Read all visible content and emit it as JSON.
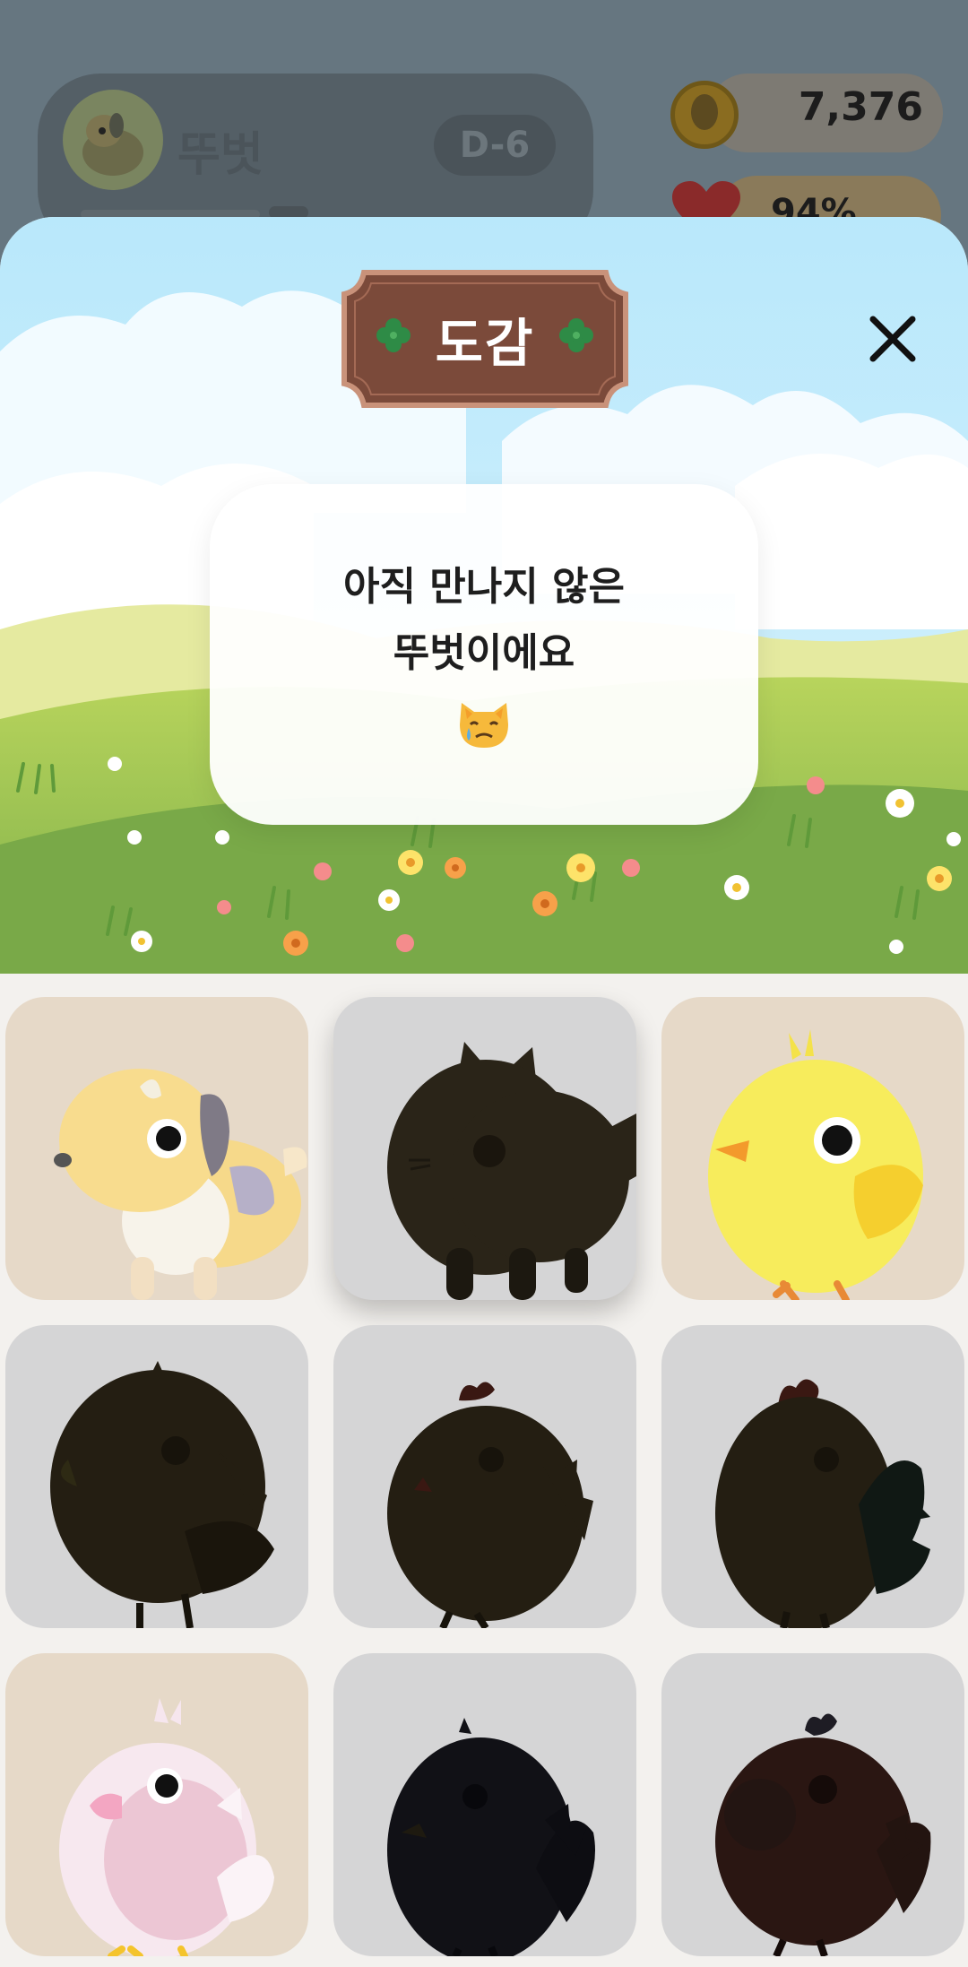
{
  "hud": {
    "pet_name": "뚜벗",
    "dday": "D-6",
    "coins": "7,376",
    "health": "94%"
  },
  "modal": {
    "title": "도감",
    "close_icon": "close-icon",
    "message_line1": "아직 만나지 않은",
    "message_line2": "뚜벗이에요",
    "message_emoji": "crying-cat-emoji"
  },
  "collection": {
    "items": [
      {
        "name": "dog",
        "status": "found",
        "selected": false
      },
      {
        "name": "cat",
        "status": "locked",
        "selected": true
      },
      {
        "name": "chick",
        "status": "found",
        "selected": false
      },
      {
        "name": "bird",
        "status": "locked",
        "selected": false
      },
      {
        "name": "hen",
        "status": "locked",
        "selected": false
      },
      {
        "name": "rooster",
        "status": "locked",
        "selected": false
      },
      {
        "name": "pink-bird",
        "status": "found",
        "selected": false
      },
      {
        "name": "crow",
        "status": "locked",
        "selected": false
      },
      {
        "name": "brown-rooster",
        "status": "locked",
        "selected": false
      }
    ]
  },
  "colors": {
    "plate": "#7b4a3a",
    "plate_border": "#c9927a",
    "clover": "#2e8b46",
    "found_tile": "#e6d9c8",
    "locked_tile": "#d5d5d6"
  }
}
